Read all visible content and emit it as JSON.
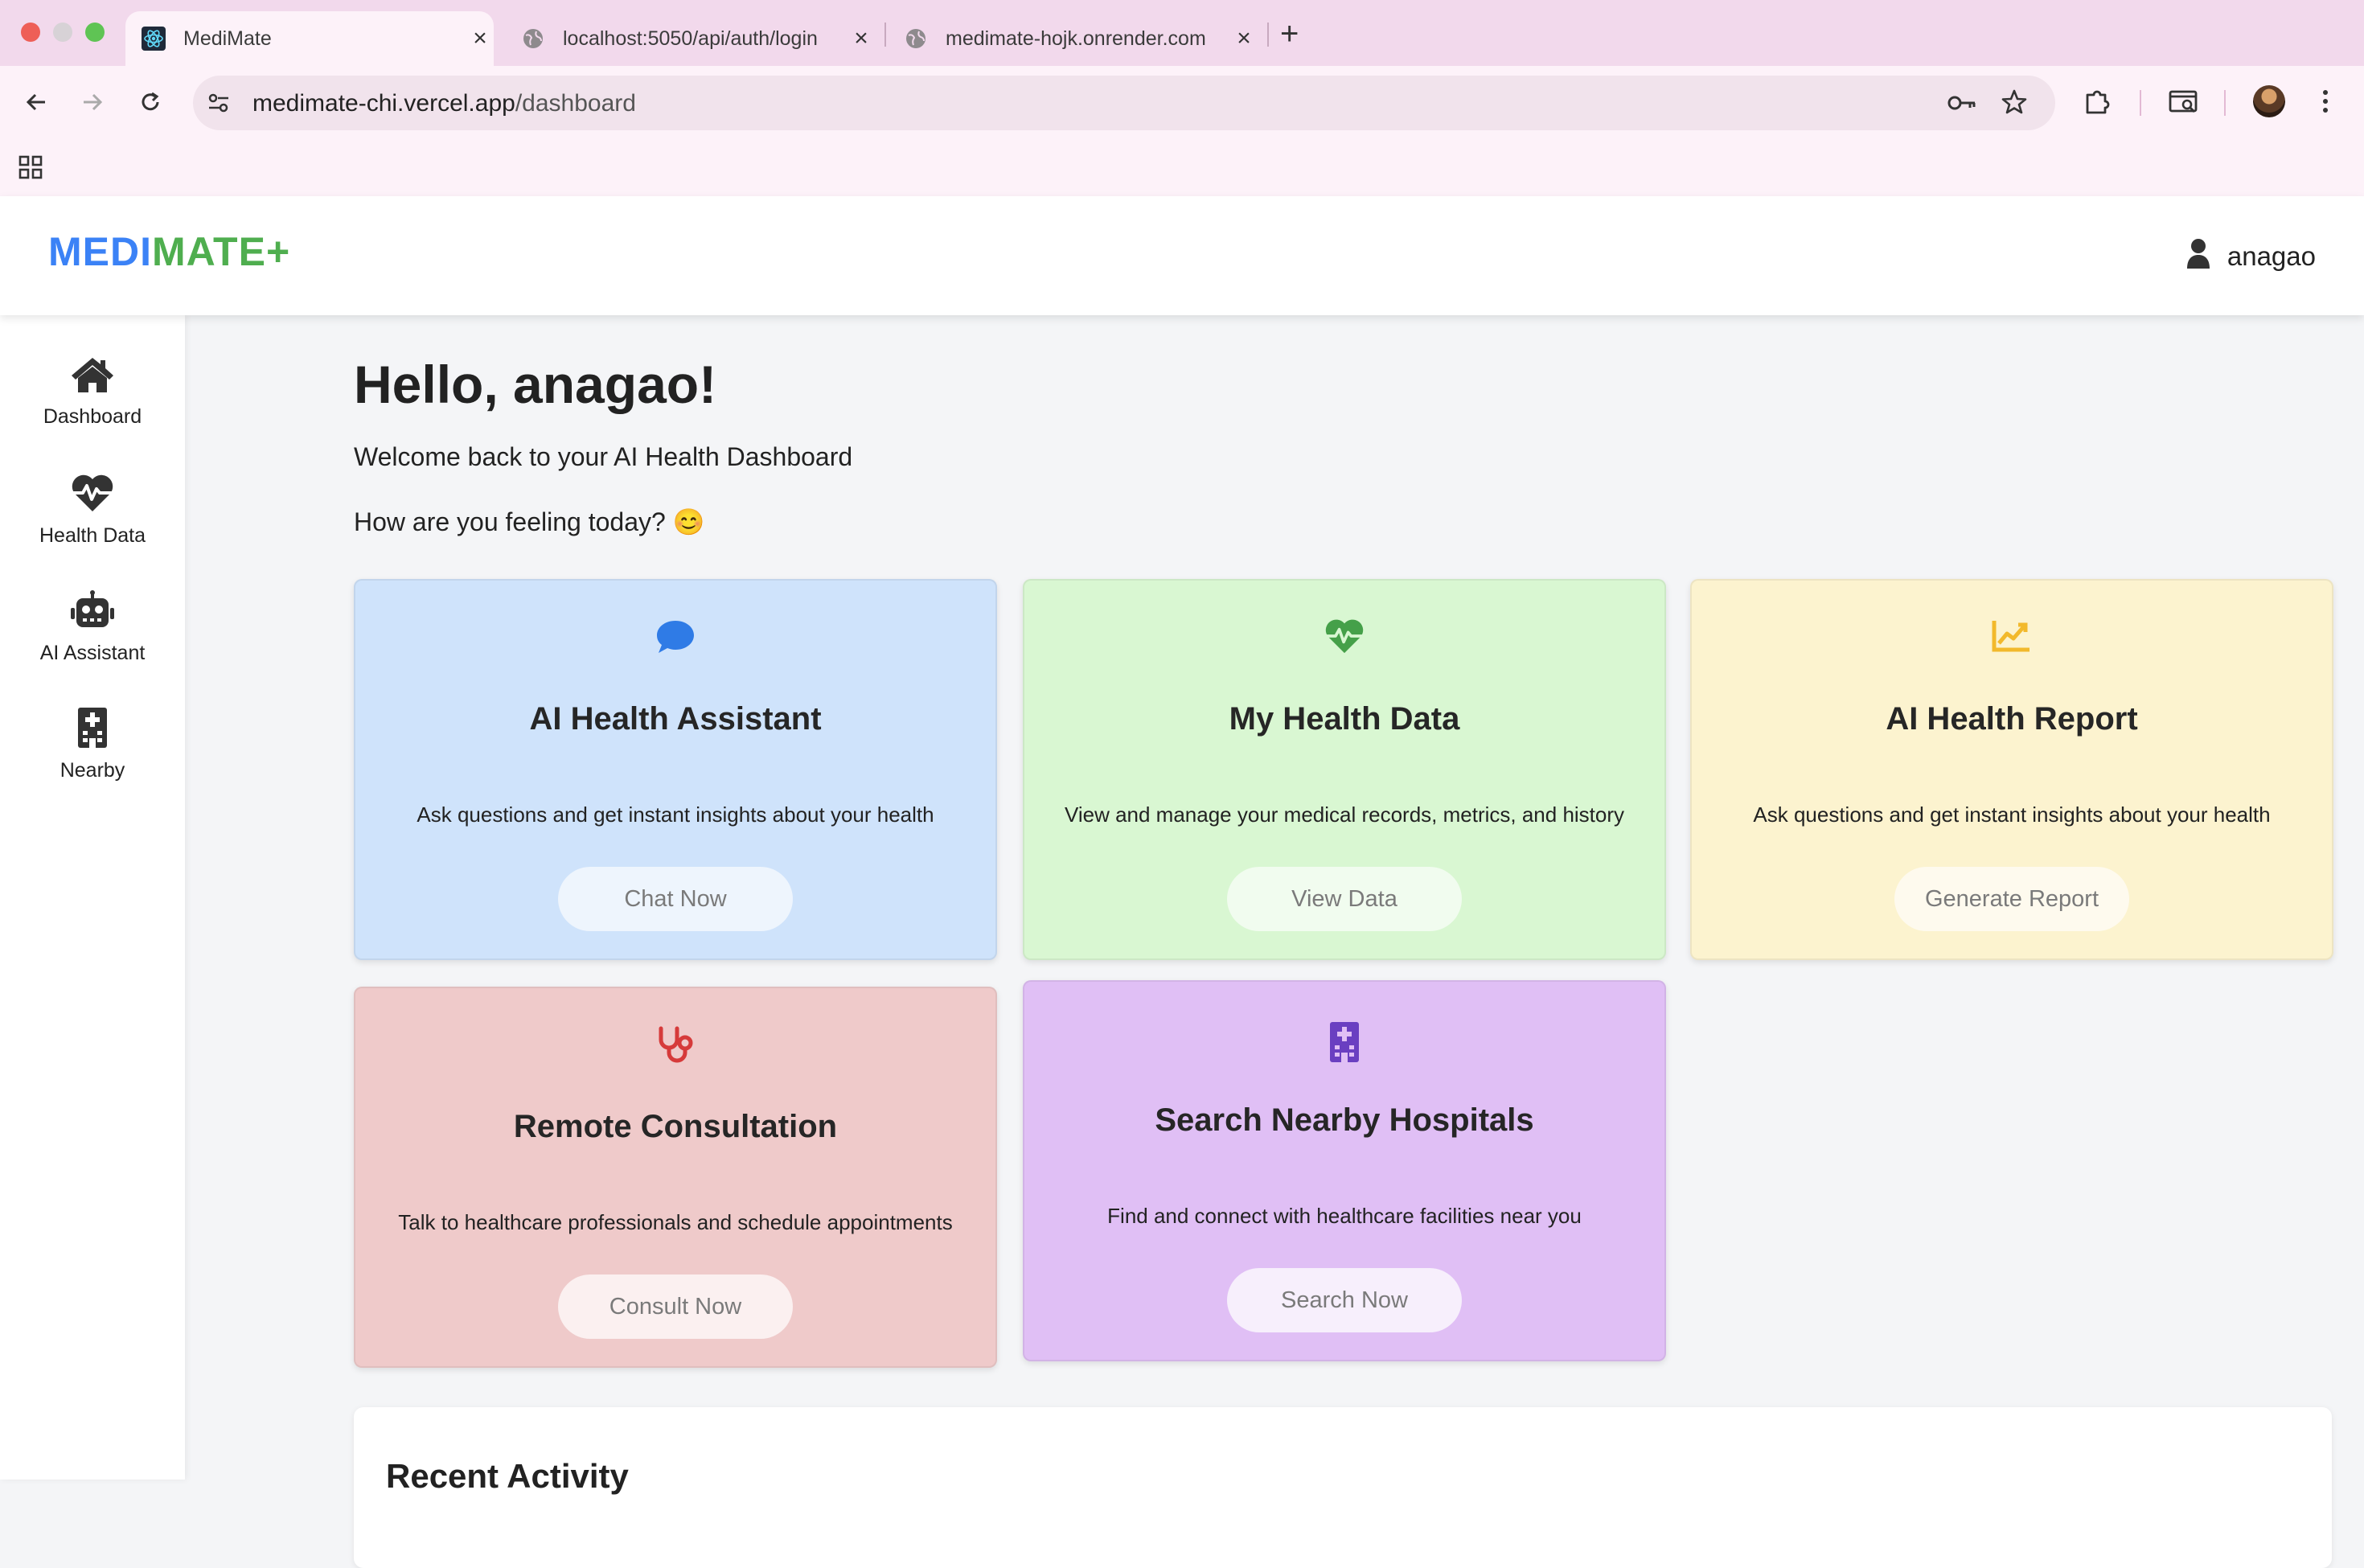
{
  "browser": {
    "tabs": [
      {
        "title": "MediMate",
        "active": true
      },
      {
        "title": "localhost:5050/api/auth/login",
        "active": false
      },
      {
        "title": "medimate-hojk.onrender.com",
        "active": false
      }
    ],
    "address": {
      "host": "medimate-chi.vercel.app",
      "path": "/dashboard"
    }
  },
  "app": {
    "logo": {
      "part1": "MEDI",
      "part2": "MATE+"
    },
    "user": {
      "name": "anagao"
    }
  },
  "sidebar": {
    "items": [
      {
        "label": "Dashboard",
        "icon": "home-icon"
      },
      {
        "label": "Health Data",
        "icon": "heartbeat-icon"
      },
      {
        "label": "AI Assistant",
        "icon": "robot-icon"
      },
      {
        "label": "Nearby",
        "icon": "hospital-icon"
      }
    ]
  },
  "main": {
    "greeting": "Hello, anagao!",
    "subtitle": "Welcome back to your AI Health Dashboard",
    "prompt": "How are you feeling today? 😊",
    "cards": [
      {
        "title": "AI Health Assistant",
        "description": "Ask questions and get instant insights about your health",
        "button": "Chat Now",
        "icon": "chat-bubble-icon",
        "color": "#cfe3fb",
        "accent": "#2f7be6"
      },
      {
        "title": "My Health Data",
        "description": "View and manage your medical records, metrics, and history",
        "button": "View Data",
        "icon": "heartbeat-icon",
        "color": "#d9f7d2",
        "accent": "#45a049"
      },
      {
        "title": "AI Health Report",
        "description": "Ask questions and get instant insights about your health",
        "button": "Generate Report",
        "icon": "chart-line-icon",
        "color": "#fcf3cf",
        "accent": "#f2b92c"
      },
      {
        "title": "Remote Consultation",
        "description": "Talk to healthcare professionals and schedule appointments",
        "button": "Consult Now",
        "icon": "stethoscope-icon",
        "color": "#efcaca",
        "accent": "#d63a3a"
      },
      {
        "title": "Search Nearby Hospitals",
        "description": "Find and connect with healthcare facilities near you",
        "button": "Search Now",
        "icon": "hospital-icon",
        "color": "#e0bff5",
        "accent": "#6a3fc1"
      }
    ],
    "recent_title": "Recent Activity"
  }
}
